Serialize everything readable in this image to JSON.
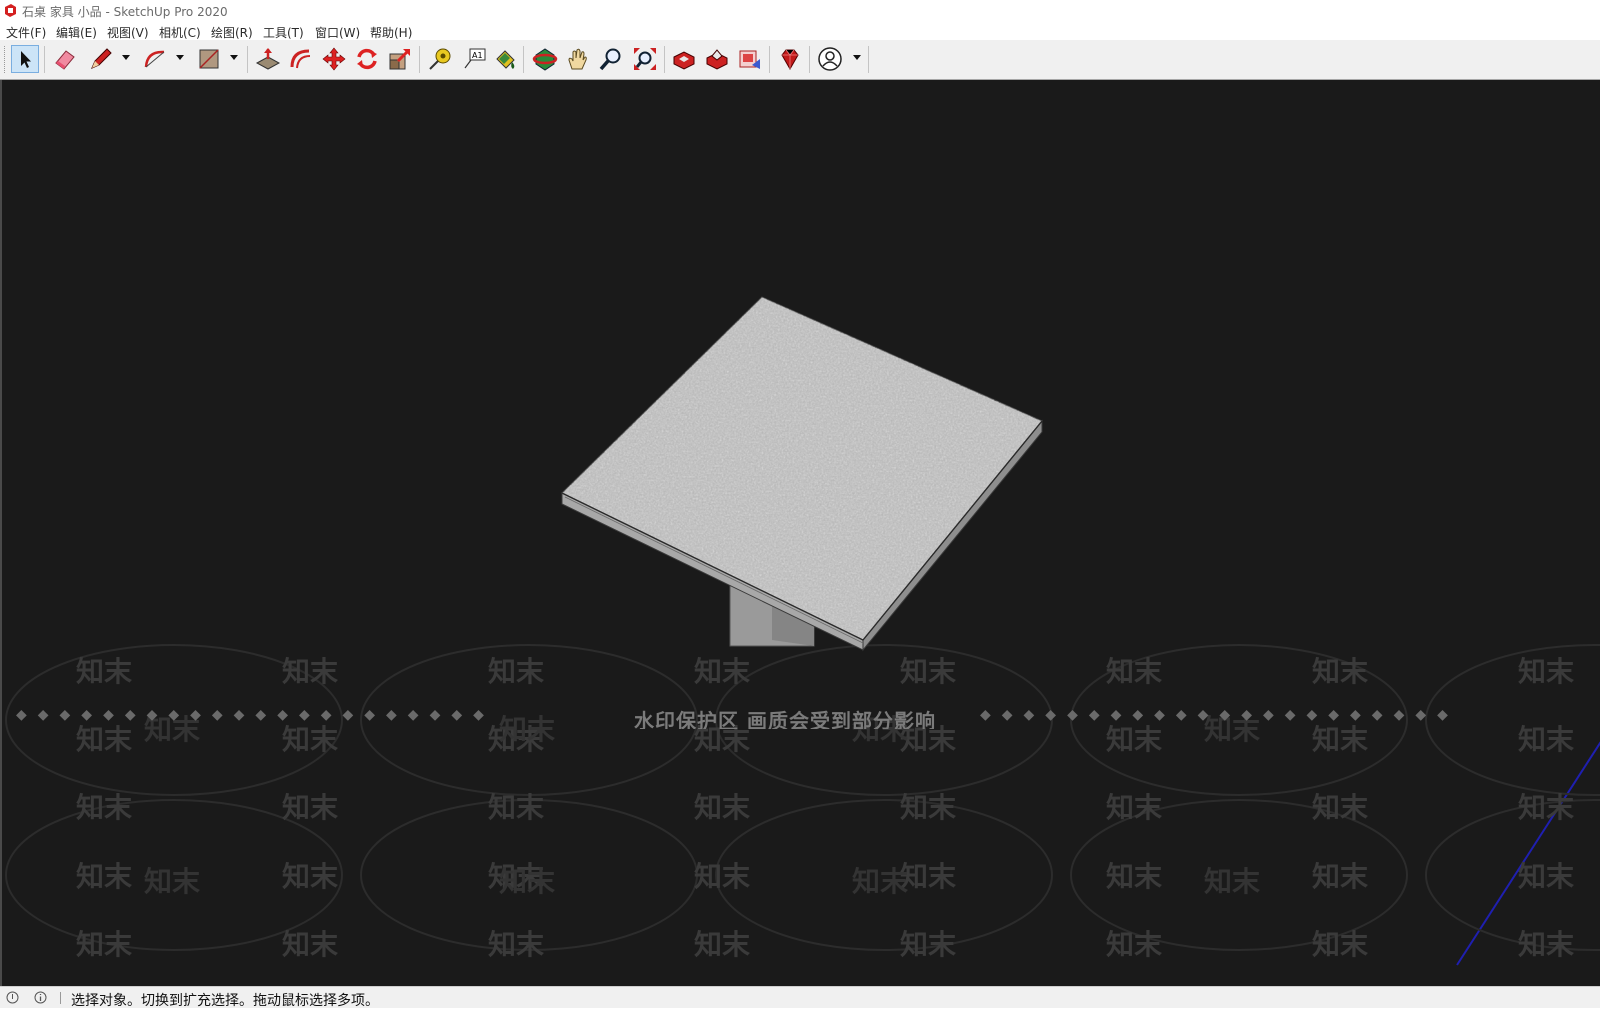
{
  "window": {
    "title": "石桌 家具 小品 - SketchUp Pro 2020"
  },
  "menu": [
    {
      "label": "文件(F)"
    },
    {
      "label": "编辑(E)"
    },
    {
      "label": "视图(V)"
    },
    {
      "label": "相机(C)"
    },
    {
      "label": "绘图(R)"
    },
    {
      "label": "工具(T)"
    },
    {
      "label": "窗口(W)"
    },
    {
      "label": "帮助(H)"
    }
  ],
  "toolbar": {
    "tools": [
      {
        "name": "select",
        "icon": "select-arrow-icon",
        "active": true
      },
      {
        "name": "eraser",
        "icon": "eraser-icon"
      },
      {
        "name": "line",
        "icon": "pencil-icon"
      },
      {
        "name": "arc",
        "icon": "arc-icon"
      },
      {
        "name": "rectangle",
        "icon": "rectangle-icon"
      },
      {
        "name": "push-pull",
        "icon": "push-pull-icon"
      },
      {
        "name": "offset",
        "icon": "offset-icon"
      },
      {
        "name": "move",
        "icon": "move-icon"
      },
      {
        "name": "rotate",
        "icon": "rotate-icon"
      },
      {
        "name": "scale",
        "icon": "scale-icon"
      },
      {
        "name": "tape-measure",
        "icon": "tape-measure-icon"
      },
      {
        "name": "text",
        "icon": "text-label-icon"
      },
      {
        "name": "paint-bucket",
        "icon": "paint-bucket-icon"
      },
      {
        "name": "orbit",
        "icon": "orbit-icon"
      },
      {
        "name": "pan",
        "icon": "pan-hand-icon"
      },
      {
        "name": "zoom",
        "icon": "zoom-icon"
      },
      {
        "name": "zoom-extents",
        "icon": "zoom-extents-icon"
      },
      {
        "name": "3d-warehouse",
        "icon": "warehouse-icon"
      },
      {
        "name": "extension-warehouse",
        "icon": "extension-warehouse-icon"
      },
      {
        "name": "layout",
        "icon": "send-to-layout-icon"
      },
      {
        "name": "ruby",
        "icon": "ruby-console-icon"
      },
      {
        "name": "account",
        "icon": "user-account-icon"
      }
    ]
  },
  "viewport": {
    "background": "#1a1a1a",
    "model": "stone table",
    "watermark_banner": "水印保护区 画质会受到部分影响",
    "watermark_text": "知末"
  },
  "status": {
    "text": "选择对象。切换到扩充选择。拖动鼠标选择多项。"
  },
  "colors": {
    "toolbar_bg": "#f0f0f0",
    "stone": "#b4b4b4",
    "axis_blue": "#1f1fb0"
  }
}
